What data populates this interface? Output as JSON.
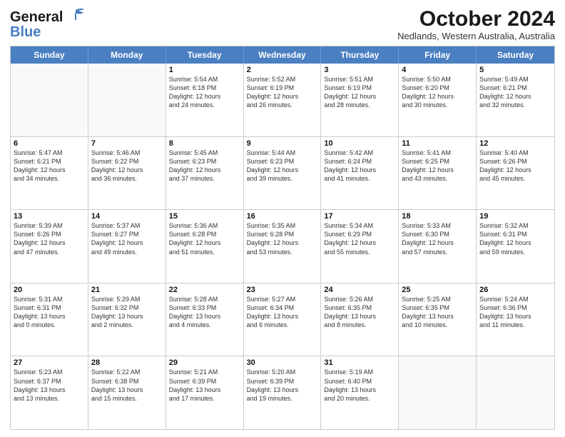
{
  "logo": {
    "line1": "General",
    "line2": "Blue"
  },
  "title": "October 2024",
  "location": "Nedlands, Western Australia, Australia",
  "header_days": [
    "Sunday",
    "Monday",
    "Tuesday",
    "Wednesday",
    "Thursday",
    "Friday",
    "Saturday"
  ],
  "rows": [
    [
      {
        "day": "",
        "info": ""
      },
      {
        "day": "",
        "info": ""
      },
      {
        "day": "1",
        "info": "Sunrise: 5:54 AM\nSunset: 6:18 PM\nDaylight: 12 hours\nand 24 minutes."
      },
      {
        "day": "2",
        "info": "Sunrise: 5:52 AM\nSunset: 6:19 PM\nDaylight: 12 hours\nand 26 minutes."
      },
      {
        "day": "3",
        "info": "Sunrise: 5:51 AM\nSunset: 6:19 PM\nDaylight: 12 hours\nand 28 minutes."
      },
      {
        "day": "4",
        "info": "Sunrise: 5:50 AM\nSunset: 6:20 PM\nDaylight: 12 hours\nand 30 minutes."
      },
      {
        "day": "5",
        "info": "Sunrise: 5:49 AM\nSunset: 6:21 PM\nDaylight: 12 hours\nand 32 minutes."
      }
    ],
    [
      {
        "day": "6",
        "info": "Sunrise: 5:47 AM\nSunset: 6:21 PM\nDaylight: 12 hours\nand 34 minutes."
      },
      {
        "day": "7",
        "info": "Sunrise: 5:46 AM\nSunset: 6:22 PM\nDaylight: 12 hours\nand 36 minutes."
      },
      {
        "day": "8",
        "info": "Sunrise: 5:45 AM\nSunset: 6:23 PM\nDaylight: 12 hours\nand 37 minutes."
      },
      {
        "day": "9",
        "info": "Sunrise: 5:44 AM\nSunset: 6:23 PM\nDaylight: 12 hours\nand 39 minutes."
      },
      {
        "day": "10",
        "info": "Sunrise: 5:42 AM\nSunset: 6:24 PM\nDaylight: 12 hours\nand 41 minutes."
      },
      {
        "day": "11",
        "info": "Sunrise: 5:41 AM\nSunset: 6:25 PM\nDaylight: 12 hours\nand 43 minutes."
      },
      {
        "day": "12",
        "info": "Sunrise: 5:40 AM\nSunset: 6:26 PM\nDaylight: 12 hours\nand 45 minutes."
      }
    ],
    [
      {
        "day": "13",
        "info": "Sunrise: 5:39 AM\nSunset: 6:26 PM\nDaylight: 12 hours\nand 47 minutes."
      },
      {
        "day": "14",
        "info": "Sunrise: 5:37 AM\nSunset: 6:27 PM\nDaylight: 12 hours\nand 49 minutes."
      },
      {
        "day": "15",
        "info": "Sunrise: 5:36 AM\nSunset: 6:28 PM\nDaylight: 12 hours\nand 51 minutes."
      },
      {
        "day": "16",
        "info": "Sunrise: 5:35 AM\nSunset: 6:28 PM\nDaylight: 12 hours\nand 53 minutes."
      },
      {
        "day": "17",
        "info": "Sunrise: 5:34 AM\nSunset: 6:29 PM\nDaylight: 12 hours\nand 55 minutes."
      },
      {
        "day": "18",
        "info": "Sunrise: 5:33 AM\nSunset: 6:30 PM\nDaylight: 12 hours\nand 57 minutes."
      },
      {
        "day": "19",
        "info": "Sunrise: 5:32 AM\nSunset: 6:31 PM\nDaylight: 12 hours\nand 59 minutes."
      }
    ],
    [
      {
        "day": "20",
        "info": "Sunrise: 5:31 AM\nSunset: 6:31 PM\nDaylight: 13 hours\nand 0 minutes."
      },
      {
        "day": "21",
        "info": "Sunrise: 5:29 AM\nSunset: 6:32 PM\nDaylight: 13 hours\nand 2 minutes."
      },
      {
        "day": "22",
        "info": "Sunrise: 5:28 AM\nSunset: 6:33 PM\nDaylight: 13 hours\nand 4 minutes."
      },
      {
        "day": "23",
        "info": "Sunrise: 5:27 AM\nSunset: 6:34 PM\nDaylight: 13 hours\nand 6 minutes."
      },
      {
        "day": "24",
        "info": "Sunrise: 5:26 AM\nSunset: 6:35 PM\nDaylight: 13 hours\nand 8 minutes."
      },
      {
        "day": "25",
        "info": "Sunrise: 5:25 AM\nSunset: 6:35 PM\nDaylight: 13 hours\nand 10 minutes."
      },
      {
        "day": "26",
        "info": "Sunrise: 5:24 AM\nSunset: 6:36 PM\nDaylight: 13 hours\nand 11 minutes."
      }
    ],
    [
      {
        "day": "27",
        "info": "Sunrise: 5:23 AM\nSunset: 6:37 PM\nDaylight: 13 hours\nand 13 minutes."
      },
      {
        "day": "28",
        "info": "Sunrise: 5:22 AM\nSunset: 6:38 PM\nDaylight: 13 hours\nand 15 minutes."
      },
      {
        "day": "29",
        "info": "Sunrise: 5:21 AM\nSunset: 6:39 PM\nDaylight: 13 hours\nand 17 minutes."
      },
      {
        "day": "30",
        "info": "Sunrise: 5:20 AM\nSunset: 6:39 PM\nDaylight: 13 hours\nand 19 minutes."
      },
      {
        "day": "31",
        "info": "Sunrise: 5:19 AM\nSunset: 6:40 PM\nDaylight: 13 hours\nand 20 minutes."
      },
      {
        "day": "",
        "info": ""
      },
      {
        "day": "",
        "info": ""
      }
    ]
  ]
}
